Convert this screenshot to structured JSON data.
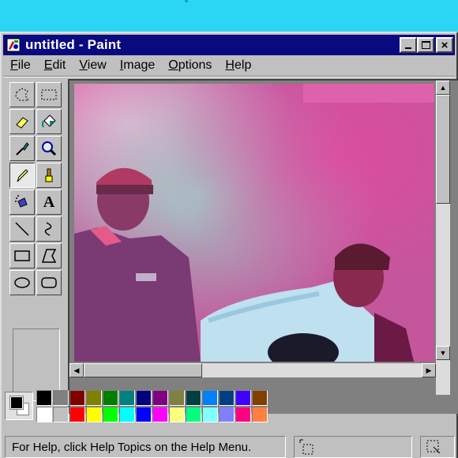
{
  "window": {
    "title": "untitled - Paint",
    "minimize": "_",
    "maximize": "□",
    "close": "×"
  },
  "menu": [
    {
      "label": "File",
      "key": "F",
      "rest": "ile"
    },
    {
      "label": "Edit",
      "key": "E",
      "rest": "dit"
    },
    {
      "label": "View",
      "key": "V",
      "rest": "iew"
    },
    {
      "label": "Image",
      "key": "I",
      "rest": "mage"
    },
    {
      "label": "Options",
      "key": "O",
      "rest": "ptions"
    },
    {
      "label": "Help",
      "key": "H",
      "rest": "elp"
    }
  ],
  "tools": [
    {
      "name": "free-form-select-icon"
    },
    {
      "name": "rect-select-icon"
    },
    {
      "name": "eraser-icon"
    },
    {
      "name": "fill-bucket-icon"
    },
    {
      "name": "color-picker-icon"
    },
    {
      "name": "magnifier-icon"
    },
    {
      "name": "pencil-icon",
      "active": true
    },
    {
      "name": "brush-icon"
    },
    {
      "name": "airbrush-icon"
    },
    {
      "name": "text-icon",
      "glyph": "A"
    },
    {
      "name": "line-icon"
    },
    {
      "name": "curve-icon"
    },
    {
      "name": "rectangle-icon"
    },
    {
      "name": "polygon-icon"
    },
    {
      "name": "ellipse-icon"
    },
    {
      "name": "rounded-rect-icon"
    }
  ],
  "colors": {
    "foreground": "#000000",
    "background": "#ffffff",
    "palette_top": [
      "#000000",
      "#808080",
      "#800000",
      "#808000",
      "#008000",
      "#008080",
      "#000080",
      "#800080",
      "#808040",
      "#004040",
      "#0080ff",
      "#004080",
      "#4000ff",
      "#804000"
    ],
    "palette_bottom": [
      "#ffffff",
      "#c0c0c0",
      "#ff0000",
      "#ffff00",
      "#00ff00",
      "#00ffff",
      "#0000ff",
      "#ff00ff",
      "#ffff80",
      "#00ff80",
      "#80ffff",
      "#8080ff",
      "#ff0080",
      "#ff8040"
    ]
  },
  "status": {
    "help_text": "For Help, click Help Topics on the Help Menu."
  }
}
